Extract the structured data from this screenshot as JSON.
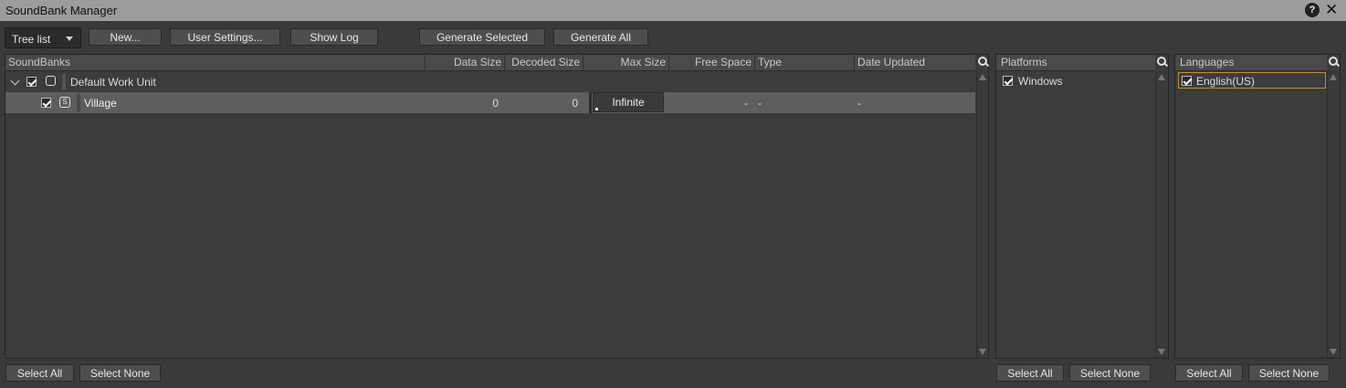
{
  "window": {
    "title": "SoundBank Manager",
    "help_glyph": "?",
    "close_glyph": "✕"
  },
  "toolbar": {
    "view_mode": "Tree list",
    "new_label": "New...",
    "user_settings_label": "User Settings...",
    "show_log_label": "Show Log",
    "generate_selected_label": "Generate Selected",
    "generate_all_label": "Generate All"
  },
  "soundbanks": {
    "columns": [
      "SoundBanks",
      "Data Size",
      "Decoded Size",
      "Max Size",
      "Free Space",
      "Type",
      "Date Updated"
    ],
    "work_unit": {
      "name": "Default Work Unit",
      "checked": true,
      "expanded": true,
      "icon": "work-unit-icon"
    },
    "rows": [
      {
        "name": "Village",
        "checked": true,
        "icon": "soundbank-icon",
        "data_size": "0",
        "decoded_size": "0",
        "max_size": "Infinite",
        "free_space": "-",
        "type": "-",
        "date_updated": "-"
      }
    ],
    "select_all_label": "Select All",
    "select_none_label": "Select None"
  },
  "platforms": {
    "header": "Platforms",
    "items": [
      {
        "label": "Windows",
        "checked": true
      }
    ],
    "select_all_label": "Select All",
    "select_none_label": "Select None"
  },
  "languages": {
    "header": "Languages",
    "items": [
      {
        "label": "English(US)",
        "checked": true
      }
    ],
    "select_all_label": "Select All",
    "select_none_label": "Select None"
  },
  "colors": {
    "accent_selection": "#c98a2e",
    "row_selected": "#5e5e5e",
    "titlebar": "#9c9c9c"
  }
}
